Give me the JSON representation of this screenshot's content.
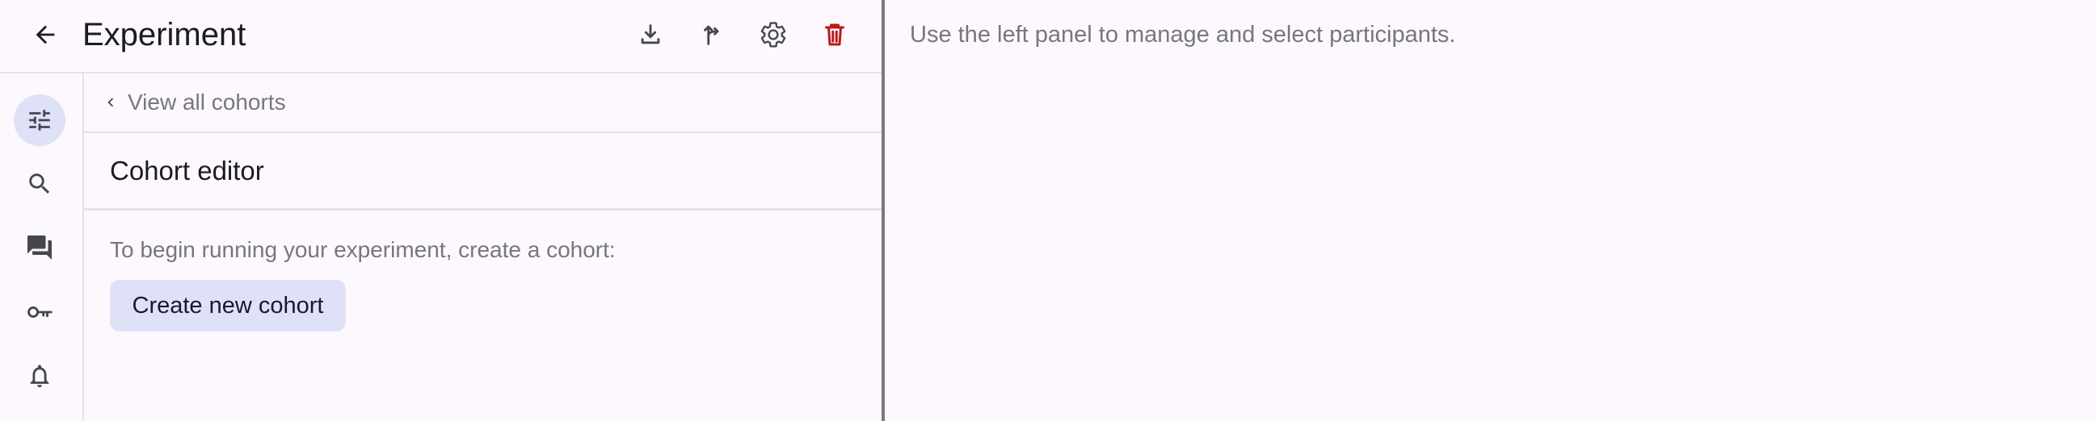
{
  "header": {
    "title": "Experiment",
    "back_icon": "arrow-left-icon",
    "actions": [
      {
        "name": "download",
        "icon": "download-icon"
      },
      {
        "name": "fork",
        "icon": "fork-icon"
      },
      {
        "name": "settings",
        "icon": "gear-icon"
      },
      {
        "name": "delete",
        "icon": "trash-icon",
        "color": "#ba1a1a"
      }
    ]
  },
  "rail": {
    "items": [
      {
        "name": "settings",
        "icon": "sliders-icon",
        "active": true
      },
      {
        "name": "search",
        "icon": "search-icon",
        "active": false
      },
      {
        "name": "chat",
        "icon": "chat-icon",
        "active": false
      },
      {
        "name": "keys",
        "icon": "key-icon",
        "active": false
      },
      {
        "name": "notifications",
        "icon": "bell-icon",
        "active": false
      }
    ]
  },
  "panel": {
    "breadcrumb": "View all cohorts",
    "section_title": "Cohort editor",
    "hint": "To begin running your experiment, create a cohort:",
    "create_button": "Create new cohort"
  },
  "right": {
    "hint": "Use the left panel to manage and select participants."
  },
  "colors": {
    "background": "#fcf8fd",
    "accent_container": "#dfe1f7",
    "danger": "#ba1a1a",
    "muted_text": "#777680",
    "divider": "#7a7981"
  }
}
